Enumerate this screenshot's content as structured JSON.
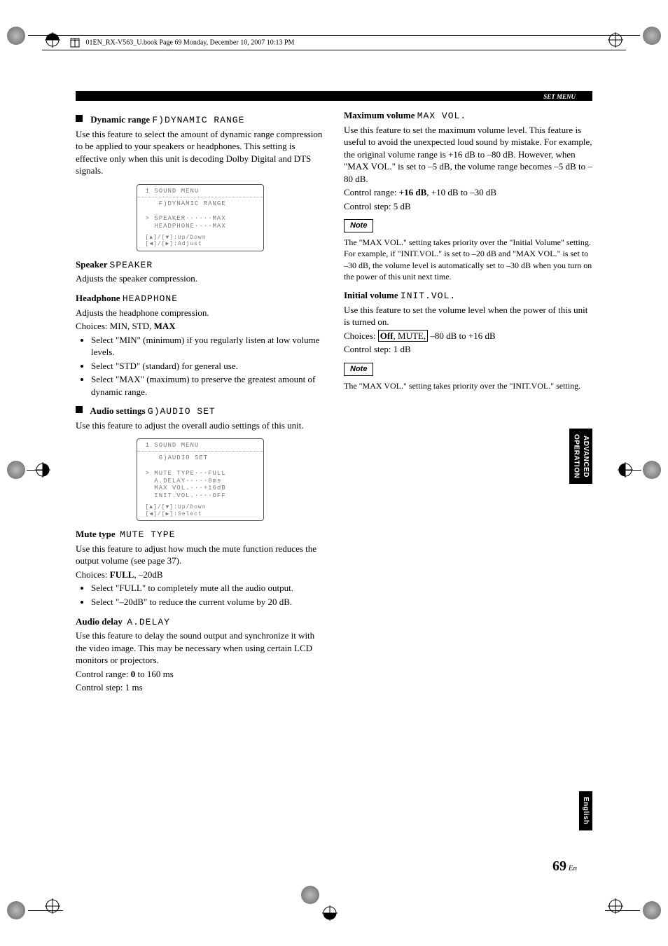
{
  "file_header": "01EN_RX-V563_U.book  Page 69  Monday, December 10, 2007  10:13 PM",
  "section_header": "SET MENU",
  "side_tab_1a": "ADVANCED",
  "side_tab_1b": "OPERATION",
  "side_tab_2": "English",
  "page_number": "69",
  "page_lang": "En",
  "left": {
    "dyn": {
      "title": "Dynamic range",
      "osd": "F)DYNAMIC RANGE",
      "desc": "Use this feature to select the amount of dynamic range compression to be applied to your speakers or headphones. This setting is effective only when this unit is decoding Dolby Digital and DTS signals.",
      "lcd_hdr": "1 SOUND MENU",
      "lcd_sub": "F)DYNAMIC RANGE",
      "lcd_rows": "> SPEAKER······MAX\n  HEADPHONE····MAX",
      "lcd_hints": "[▲]/[▼]:Up/Down\n[◀]/[▶]:Adjust",
      "speaker_t": "Speaker",
      "speaker_osd": "SPEAKER",
      "speaker_d": "Adjusts the speaker compression.",
      "hp_t": "Headphone",
      "hp_osd": "HEADPHONE",
      "hp_d": "Adjusts the headphone compression.",
      "choices_l": "Choices: MIN, STD, ",
      "choices_b": "MAX",
      "li1": "Select \"MIN\" (minimum) if you regularly listen at low volume levels.",
      "li2": "Select \"STD\" (standard) for general use.",
      "li3": "Select \"MAX\" (maximum) to preserve the greatest amount of dynamic range."
    },
    "aud": {
      "title": "Audio settings",
      "osd": "G)AUDIO SET",
      "desc": "Use this feature to adjust the overall audio settings of this unit.",
      "lcd_hdr": "1 SOUND MENU",
      "lcd_sub": "G)AUDIO SET",
      "lcd_rows": "> MUTE TYPE···FULL\n  A.DELAY·····0ms\n  MAX VOL.···+16dB\n  INIT.VOL.····OFF",
      "lcd_hints": "[▲]/[▼]:Up/Down\n[◀]/[▶]:Select",
      "mute_t": "Mute type",
      "mute_osd": "MUTE TYPE",
      "mute_d": "Use this feature to adjust how much the mute function reduces the output volume (see page 37).",
      "mute_ch_l": "Choices: ",
      "mute_ch_b": "FULL",
      "mute_ch_r": ", –20dB",
      "mute_li1": "Select \"FULL\" to completely mute all the audio output.",
      "mute_li2": "Select \"–20dB\" to reduce the current volume by 20 dB.",
      "ad_t": "Audio delay",
      "ad_osd": "A.DELAY",
      "ad_d": "Use this feature to delay the sound output and synchronize it with the video image. This may be necessary when using certain LCD monitors or projectors.",
      "ad_r_l": "Control range: ",
      "ad_r_b": "0",
      "ad_r_r": " to 160 ms",
      "ad_step": "Control step: 1 ms"
    }
  },
  "right": {
    "max": {
      "t": "Maximum volume",
      "osd": "MAX VOL.",
      "d": "Use this feature to set the maximum volume level. This feature is useful to avoid the unexpected loud sound by mistake. For example, the original volume range is +16 dB to –80 dB. However, when \"MAX VOL.\" is set to –5 dB, the volume range becomes –5 dB to –80 dB.",
      "r_l": "Control range: ",
      "r_b": "+16 dB",
      "r_r": ", +10 dB to –30 dB",
      "step": "Control step: 5 dB",
      "note_l": "Note",
      "note_t": "The \"MAX VOL.\" setting takes priority over the \"Initial Volume\" setting. For example, if \"INIT.VOL.\" is set to –20 dB and \"MAX VOL.\" is set to –30 dB, the volume level is automatically set to –30 dB when you turn on the power of this unit next time."
    },
    "init": {
      "t": "Initial volume",
      "osd": "INIT.VOL.",
      "d": "Use this feature to set the volume level when the power of this unit is turned on.",
      "ch_l": "Choices: ",
      "ch_box": "Off, MUTE,",
      "ch_b": "Off",
      "ch_r": " –80 dB to +16 dB",
      "step": "Control step: 1 dB",
      "note_l": "Note",
      "note_t": "The \"MAX VOL.\" setting takes priority over the \"INIT.VOL.\" setting."
    }
  }
}
